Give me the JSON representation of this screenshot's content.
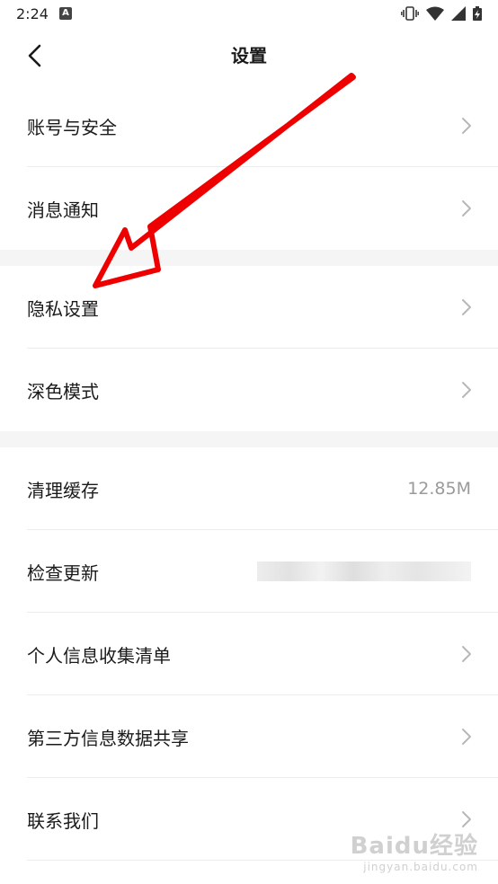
{
  "status_bar": {
    "time": "2:24",
    "notif_letter": "A"
  },
  "header": {
    "title": "设置"
  },
  "groups": [
    {
      "items": [
        {
          "label": "账号与安全",
          "trailing": "chevron"
        },
        {
          "label": "消息通知",
          "trailing": "chevron"
        }
      ]
    },
    {
      "items": [
        {
          "label": "隐私设置",
          "trailing": "chevron"
        },
        {
          "label": "深色模式",
          "trailing": "chevron"
        }
      ]
    },
    {
      "items": [
        {
          "label": "清理缓存",
          "trailing": "value",
          "value": "12.85M"
        },
        {
          "label": "检查更新",
          "trailing": "blurred"
        },
        {
          "label": "个人信息收集清单",
          "trailing": "chevron"
        },
        {
          "label": "第三方信息数据共享",
          "trailing": "chevron"
        },
        {
          "label": "联系我们",
          "trailing": "chevron"
        }
      ]
    }
  ],
  "watermark": {
    "logo": "Baidu经验",
    "sub": "jingyan.baidu.com"
  },
  "colors": {
    "annotation_arrow": "#ee0000",
    "separator": "#f5f5f5",
    "secondary_text": "#9a9a9a"
  }
}
